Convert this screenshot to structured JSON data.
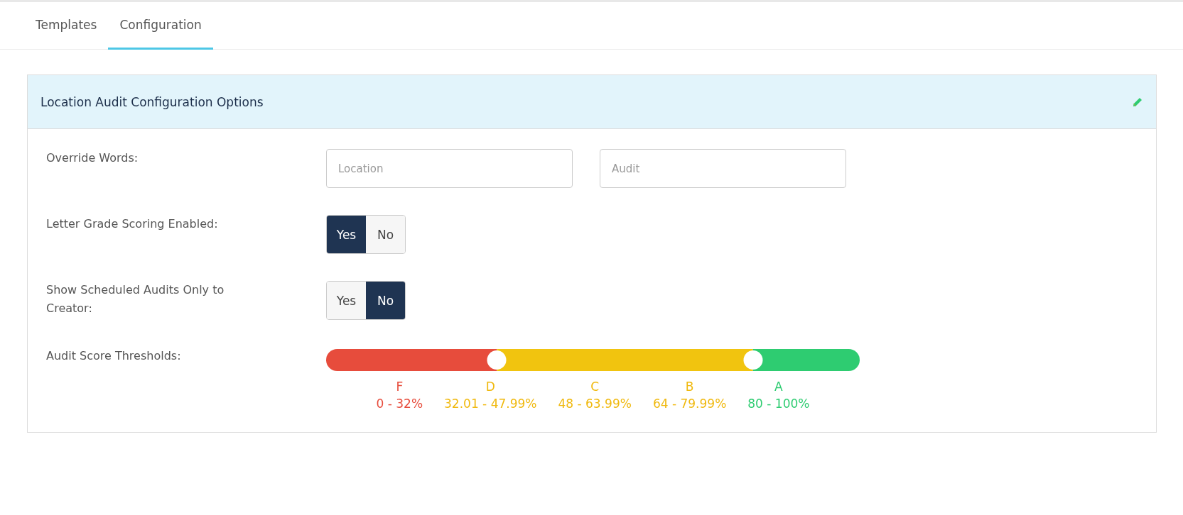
{
  "tabs": [
    {
      "label": "Templates",
      "selected": false
    },
    {
      "label": "Configuration",
      "selected": true
    }
  ],
  "panel": {
    "title": "Location Audit Configuration Options",
    "override_words": {
      "label": "Override Words:",
      "fields": [
        {
          "placeholder": "Location"
        },
        {
          "placeholder": "Audit"
        }
      ]
    },
    "toggles": [
      {
        "label": "Letter Grade Scoring Enabled:",
        "options": [
          {
            "label": "Yes",
            "selected": true
          },
          {
            "label": "No",
            "selected": false
          }
        ]
      },
      {
        "label": "Show Scheduled Audits Only to Creator:",
        "options": [
          {
            "label": "Yes",
            "selected": false
          },
          {
            "label": "No",
            "selected": true
          }
        ]
      }
    ],
    "thresholds": {
      "label": "Audit Score Thresholds:",
      "segments": [
        {
          "color": "#e74c3c"
        },
        {
          "color": "#f1c40f"
        },
        {
          "color": "#2ecc71"
        }
      ],
      "thumbs": [
        {
          "level": 0.32
        },
        {
          "level": 0.8
        }
      ],
      "grades": [
        {
          "letter": "F",
          "range": "0 - 32%",
          "color": "#e74c3c"
        },
        {
          "letter": "D",
          "range": "32.01 - 47.99%",
          "color": "#f0b90f"
        },
        {
          "letter": "C",
          "range": "48 - 63.99%",
          "color": "#f0b90f"
        },
        {
          "letter": "B",
          "range": "64 - 79.99%",
          "color": "#f0b90f"
        },
        {
          "letter": "A",
          "range": "80 - 100%",
          "color": "#2ecc71"
        }
      ]
    }
  }
}
